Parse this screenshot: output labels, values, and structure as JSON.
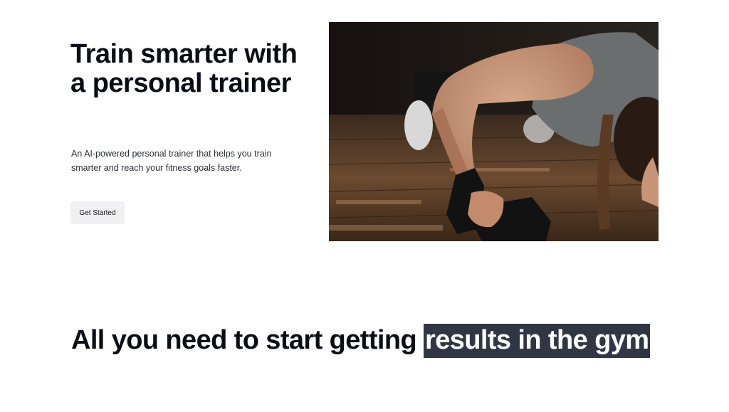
{
  "hero": {
    "title": "Train smarter with a personal trainer",
    "subtitle": "An AI-powered personal trainer that helps you train smarter and reach your fitness goals faster.",
    "cta_label": "Get Started"
  },
  "features": {
    "heading_plain": "All you need to start getting ",
    "heading_highlight": "results in the gym"
  },
  "colors": {
    "heading_text": "#0b0d14",
    "button_bg": "#f0f0f2",
    "highlight_bg": "#303644"
  }
}
